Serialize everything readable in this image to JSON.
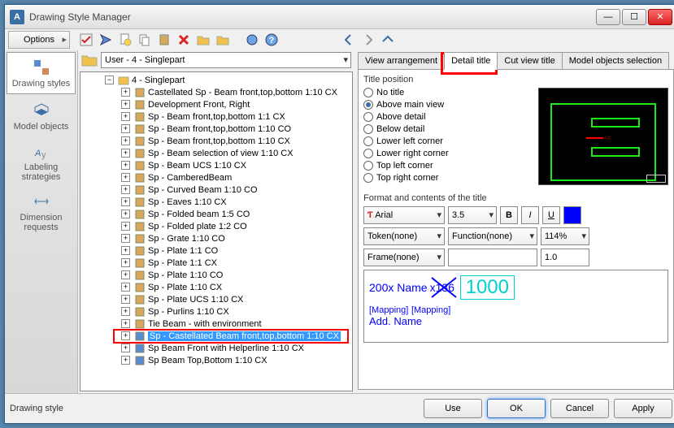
{
  "window": {
    "title": "Drawing Style Manager"
  },
  "toolbar": {
    "options": "Options"
  },
  "sidebar": {
    "items": [
      {
        "label": "Drawing styles"
      },
      {
        "label": "Model objects"
      },
      {
        "label": "Labeling strategies"
      },
      {
        "label": "Dimension requests"
      }
    ]
  },
  "path": {
    "text": "User - 4 - Singlepart"
  },
  "tree": {
    "root": "4 - Singlepart",
    "items": [
      "Castellated Sp - Beam front,top,bottom 1:10 CX",
      "Development Front, Right",
      "Sp - Beam front,top,bottom 1:1 CX",
      "Sp - Beam front,top,bottom 1:10 CO",
      "Sp - Beam front,top,bottom 1:10 CX",
      "Sp - Beam selection of view 1:10 CX",
      "Sp - Beam UCS 1:10 CX",
      "Sp - CamberedBeam",
      "Sp - Curved Beam 1:10 CO",
      "Sp - Eaves 1:10 CX",
      "Sp - Folded beam 1:5 CO",
      "Sp - Folded plate 1:2 CO",
      "Sp - Grate 1:10 CO",
      "Sp - Plate 1:1 CO",
      "Sp - Plate 1:1 CX",
      "Sp - Plate 1:10 CO",
      "Sp - Plate 1:10 CX",
      "Sp - Plate UCS 1:10 CX",
      "Sp - Purlins 1:10 CX",
      "Tie Beam - with environment",
      "Sp - Castellated Beam front,top,bottom 1:10 CX",
      "Sp Beam Front with Helperline 1:10 CX",
      "Sp Beam Top,Bottom 1:10 CX"
    ],
    "selected_index": 20
  },
  "tabs": {
    "items": [
      "View arrangement",
      "Detail title",
      "Cut view title",
      "Model objects selection"
    ],
    "active": 1
  },
  "title_position": {
    "label": "Title position",
    "options": [
      "No title",
      "Above main view",
      "Above detail",
      "Below detail",
      "Lower left corner",
      "Lower right corner",
      "Top left corner",
      "Top right corner"
    ],
    "selected": 1
  },
  "format": {
    "label": "Format and contents of the title",
    "font": "Arial",
    "size": "3.5",
    "token": "Token(none)",
    "function": "Function(none)",
    "percent": "114%",
    "frame": "Frame(none)",
    "framevalue": "",
    "framewidth": "1.0",
    "bold": "B",
    "italic": "I",
    "underline": "U"
  },
  "title_preview": {
    "text1": "200x Name",
    "num1": "x136",
    "num2": "1000",
    "map1": "[Mapping]",
    "map2": "[Mapping]",
    "addname": "Add. Name"
  },
  "footer": {
    "label": "Drawing style",
    "use": "Use",
    "ok": "OK",
    "cancel": "Cancel",
    "apply": "Apply"
  }
}
